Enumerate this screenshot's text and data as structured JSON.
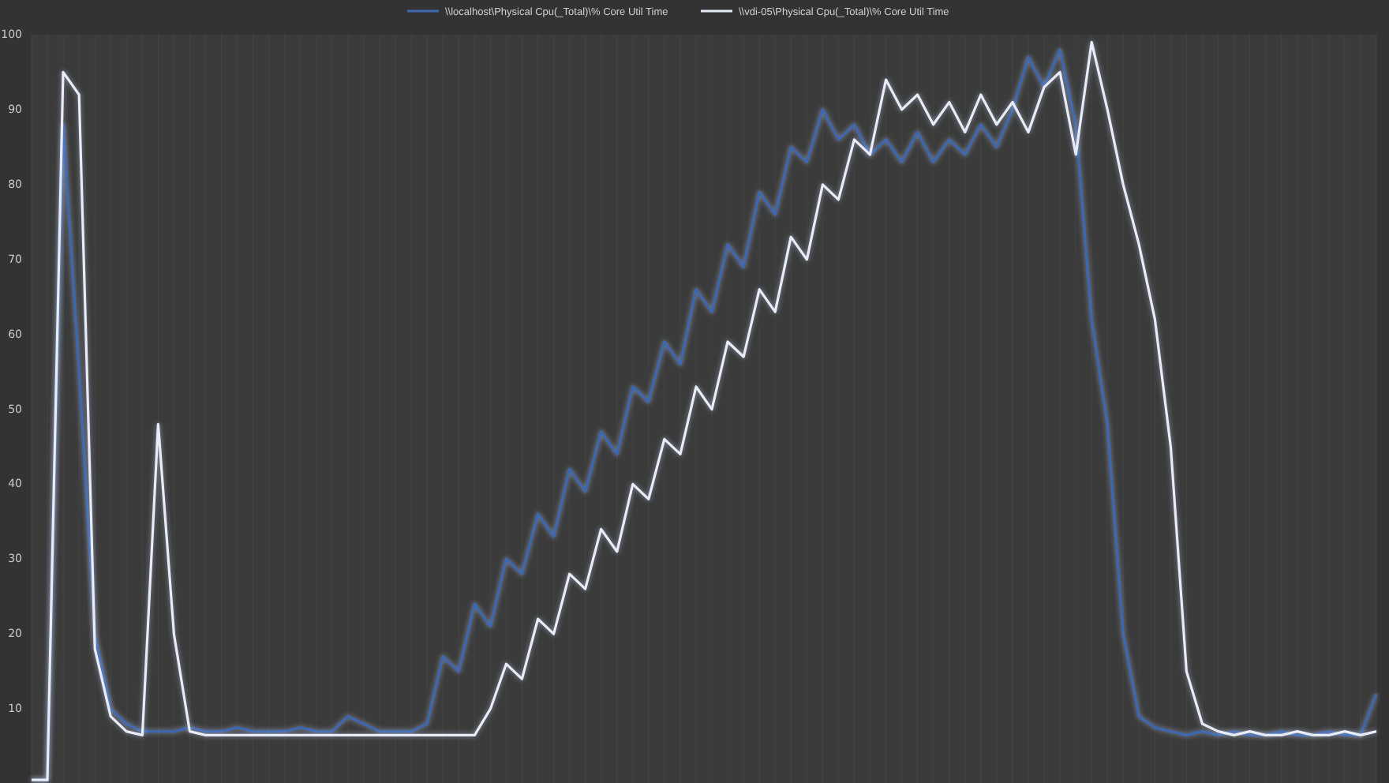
{
  "chart_data": {
    "type": "line",
    "grid": true,
    "legend": true,
    "ylim": [
      0,
      100
    ],
    "yticks": [
      10,
      20,
      30,
      40,
      50,
      60,
      70,
      80,
      90,
      100
    ],
    "series": [
      {
        "name": "\\\\localhost\\Physical Cpu(_Total)\\% Core Util Time",
        "color": "#3d68b0",
        "values": [
          0.5,
          0.5,
          88,
          55,
          20,
          10,
          8,
          7,
          7,
          7,
          7.5,
          7,
          7,
          7.5,
          7,
          7,
          7,
          7.5,
          7,
          7,
          9,
          8,
          7,
          7,
          7,
          8,
          17,
          15,
          24,
          21,
          30,
          28,
          36,
          33,
          42,
          39,
          47,
          44,
          53,
          51,
          59,
          56,
          66,
          63,
          72,
          69,
          79,
          76,
          85,
          83,
          90,
          86,
          88,
          84,
          86,
          83,
          87,
          83,
          86,
          84,
          88,
          85,
          90,
          97,
          93,
          98,
          88,
          62,
          48,
          20,
          9,
          7.5,
          7,
          6.5,
          7,
          6.5,
          7,
          6.5,
          6.5,
          7,
          6.5,
          6.5,
          7,
          6.5,
          6.5,
          12
        ]
      },
      {
        "name": "\\\\vdi-05\\Physical Cpu(_Total)\\% Core Util Time",
        "color": "#e8ecf6",
        "values": [
          0.5,
          0.5,
          95,
          92,
          18,
          9,
          7,
          6.5,
          48,
          20,
          7,
          6.5,
          6.5,
          6.5,
          6.5,
          6.5,
          6.5,
          6.5,
          6.5,
          6.5,
          6.5,
          6.5,
          6.5,
          6.5,
          6.5,
          6.5,
          6.5,
          6.5,
          6.5,
          10,
          16,
          14,
          22,
          20,
          28,
          26,
          34,
          31,
          40,
          38,
          46,
          44,
          53,
          50,
          59,
          57,
          66,
          63,
          73,
          70,
          80,
          78,
          86,
          84,
          94,
          90,
          92,
          88,
          91,
          87,
          92,
          88,
          91,
          87,
          93,
          95,
          84,
          99,
          90,
          80,
          72,
          62,
          45,
          15,
          8,
          7,
          6.5,
          7,
          6.5,
          6.5,
          7,
          6.5,
          6.5,
          7,
          6.5,
          7
        ]
      }
    ]
  }
}
